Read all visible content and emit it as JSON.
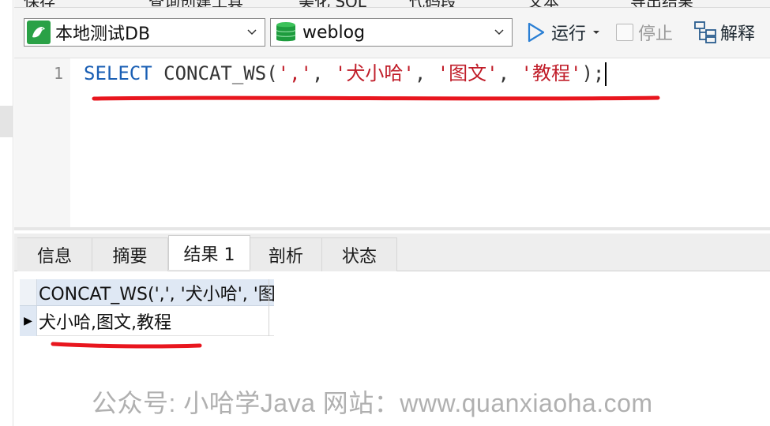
{
  "top_toolbar": {
    "ghost_items": [
      "保存",
      "查询创建工具",
      "美化 SQL",
      "代码段",
      "文本",
      "导出结果"
    ]
  },
  "toolbar": {
    "connection": {
      "label": "本地测试DB",
      "icon": "mysql-dolphin-icon",
      "icon_color": "#2aa146"
    },
    "database": {
      "label": "weblog",
      "icon": "database-icon",
      "icon_color": "#2aa146"
    },
    "run_label": "运行",
    "stop_label": "停止",
    "explain_label": "解释"
  },
  "editor": {
    "line_number": "1",
    "sql": {
      "keyword": "SELECT",
      "function": "CONCAT_WS",
      "open_paren": "(",
      "arg1": "','",
      "arg2": "'犬小哈'",
      "arg3": "'图文'",
      "arg4": "'教程'",
      "sep": ", ",
      "close": ");"
    }
  },
  "results": {
    "tabs": [
      "信息",
      "摘要",
      "结果 1",
      "剖析",
      "状态"
    ],
    "active_tab": "结果 1",
    "grid": {
      "column_header": "CONCAT_WS(',', '犬小哈', '图",
      "rows": [
        "犬小哈,图文,教程"
      ]
    }
  },
  "annotations": {
    "underline_color": "#e8161e"
  },
  "watermark": {
    "text": "公众号: 小哈学Java  网站：www.quanxiaoha.com"
  }
}
